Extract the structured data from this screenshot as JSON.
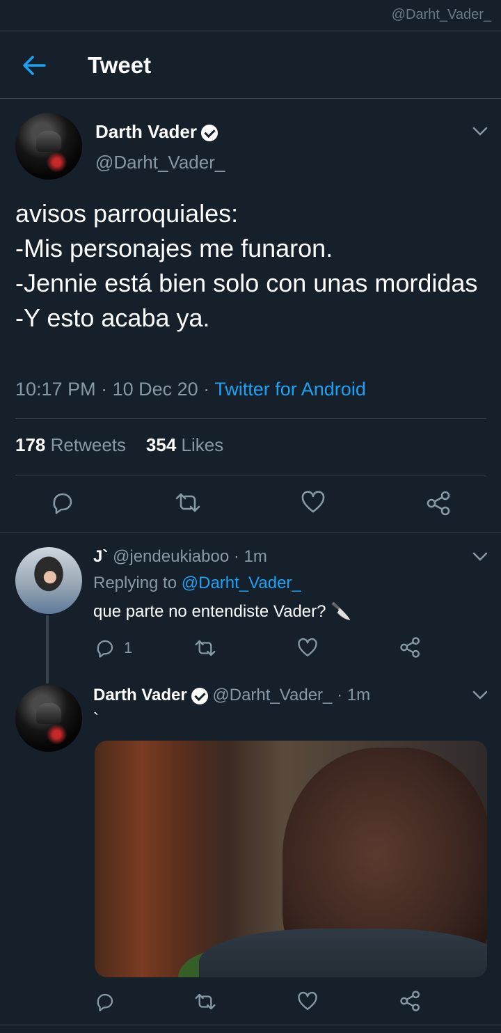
{
  "watermark": "@Darht_Vader_",
  "header": {
    "title": "Tweet"
  },
  "main_tweet": {
    "name": "Darth Vader",
    "handle": "@Darht_Vader_",
    "text": "avisos parroquiales:\n-Mis personajes me funaron.\n-Jennie está bien solo con unas mordidas\n-Y esto acaba ya.",
    "time": "10:17 PM",
    "date": "10 Dec 20",
    "separator": "·",
    "source": "Twitter for Android",
    "retweets_count": "178",
    "retweets_label": "Retweets",
    "likes_count": "354",
    "likes_label": "Likes"
  },
  "reply1": {
    "name": "J`",
    "handle": "@jendeukiaboo",
    "time": "1m",
    "replying_prefix": "Replying to",
    "replying_handle": "@Darht_Vader_",
    "text": "que parte no entendiste Vader? 🔪",
    "reply_count": "1"
  },
  "reply2": {
    "name": "Darth Vader",
    "handle": "@Darht_Vader_",
    "time": "1m",
    "text": "`"
  },
  "colors": {
    "background": "#15202b",
    "accent": "#1da1f2",
    "muted": "#8899a6",
    "divider": "#38444d"
  },
  "icons": [
    "back-arrow-icon",
    "verified-icon",
    "chevron-down-icon",
    "reply-icon",
    "retweet-icon",
    "like-icon",
    "share-icon"
  ]
}
